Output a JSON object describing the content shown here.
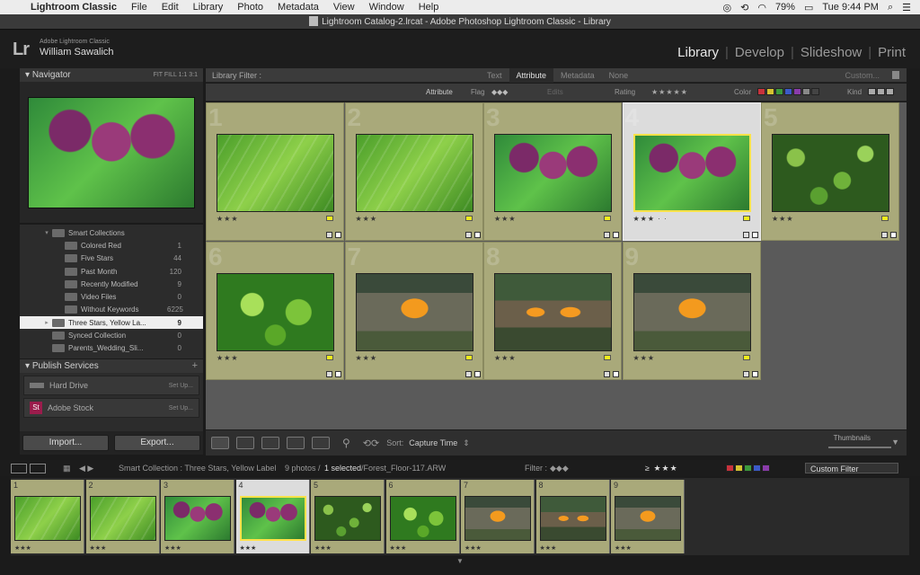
{
  "menubar": {
    "app": "Lightroom Classic",
    "items": [
      "File",
      "Edit",
      "Library",
      "Photo",
      "Metadata",
      "View",
      "Window",
      "Help"
    ],
    "battery": "79%",
    "clock": "Tue 9:44 PM"
  },
  "window_title": "Lightroom Catalog-2.lrcat - Adobe Photoshop Lightroom Classic - Library",
  "identity": {
    "logo": "Lr",
    "product": "Adobe Lightroom Classic",
    "user": "William Sawalich"
  },
  "modules": [
    "Library",
    "Develop",
    "Slideshow",
    "Print"
  ],
  "navigator": {
    "title": "Navigator",
    "zoom": "FIT  FILL  1:1  3:1"
  },
  "collections": [
    {
      "name": "Smart Collections",
      "count": "",
      "level": 0
    },
    {
      "name": "Colored Red",
      "count": "1",
      "level": 1
    },
    {
      "name": "Five Stars",
      "count": "44",
      "level": 1
    },
    {
      "name": "Past Month",
      "count": "120",
      "level": 1
    },
    {
      "name": "Recently Modified",
      "count": "9",
      "level": 1
    },
    {
      "name": "Video Files",
      "count": "0",
      "level": 1
    },
    {
      "name": "Without Keywords",
      "count": "6225",
      "level": 1
    },
    {
      "name": "Three Stars, Yellow La...",
      "count": "9",
      "level": 0,
      "selected": true
    },
    {
      "name": "Synced Collection",
      "count": "0",
      "level": 0
    },
    {
      "name": "Parents_Wedding_Sli...",
      "count": "0",
      "level": 0
    }
  ],
  "publish": {
    "title": "Publish Services",
    "services": [
      {
        "name": "Hard Drive",
        "action": "Set Up..."
      },
      {
        "name": "Adobe Stock",
        "action": "Set Up..."
      }
    ]
  },
  "buttons": {
    "import": "Import...",
    "export": "Export..."
  },
  "filter": {
    "label": "Library Filter :",
    "tabs": [
      "Text",
      "Attribute",
      "Metadata",
      "None"
    ],
    "custom": "Custom..."
  },
  "attr": {
    "attribute": "Attribute",
    "flag": "Flag",
    "edits": "Edits",
    "rating": "Rating",
    "color": "Color",
    "kind": "Kind",
    "stars": "★★★★★"
  },
  "grid": [
    {
      "n": "1",
      "img": "leaf",
      "rating": "★★★"
    },
    {
      "n": "2",
      "img": "leaf",
      "rating": "★★★"
    },
    {
      "n": "3",
      "img": "maple",
      "rating": "★★★"
    },
    {
      "n": "4",
      "img": "maple",
      "rating": "★★★ · ·",
      "selected": true
    },
    {
      "n": "5",
      "img": "shrub",
      "rating": "★★★"
    },
    {
      "n": "6",
      "img": "shrub2",
      "rating": "★★★"
    },
    {
      "n": "7",
      "img": "fungus",
      "rating": "★★★"
    },
    {
      "n": "8",
      "img": "fungus2",
      "rating": "★★★"
    },
    {
      "n": "9",
      "img": "fungus",
      "rating": "★★★"
    }
  ],
  "toolbar": {
    "sort_label": "Sort:",
    "sort_value": "Capture Time",
    "thumbnails": "Thumbnails"
  },
  "filmstrip": {
    "source": "Smart Collection : Three Stars, Yellow Label",
    "count": "9 photos /",
    "selected": "1 selected",
    "file": "/Forest_Floor-117.ARW",
    "filter_label": "Filter :",
    "rating_filter": "≥ ★★★",
    "custom_filter": "Custom Filter"
  }
}
